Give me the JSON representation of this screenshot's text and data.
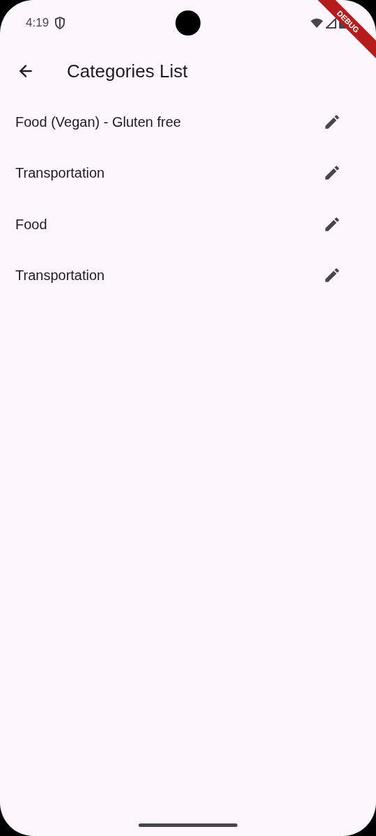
{
  "status_bar": {
    "time": "4:19"
  },
  "debug_banner": {
    "label": "DEBUG"
  },
  "app_bar": {
    "title": "Categories List"
  },
  "categories": [
    {
      "name": "Food (Vegan) - Gluten free"
    },
    {
      "name": "Transportation"
    },
    {
      "name": "Food"
    },
    {
      "name": "Transportation"
    }
  ]
}
